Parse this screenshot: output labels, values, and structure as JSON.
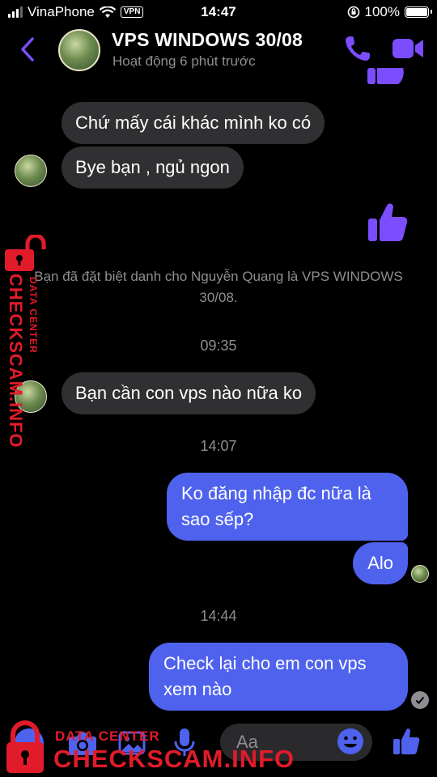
{
  "status_bar": {
    "carrier": "VinaPhone",
    "vpn": "VPN",
    "time": "14:47",
    "battery": "100%"
  },
  "header": {
    "title": "VPS WINDOWS 30/08",
    "subtitle": "Hoạt động 6 phút trước"
  },
  "messages": {
    "in_1": "Chứ mấy cái khác mình ko có",
    "in_2": "Bye bạn , ngủ ngon",
    "system_note": "Bạn đã đặt biệt danh cho Nguyễn Quang là VPS WINDOWS 30/08.",
    "time_1": "09:35",
    "in_3": "Bạn cần con vps nào nữa ko",
    "time_2": "14:07",
    "out_1": "Ko đăng nhập đc nữa là sao sếp?",
    "out_2": "Alo",
    "time_3": "14:44",
    "out_3": "Check lại cho em con vps xem nào"
  },
  "composer": {
    "placeholder": "Aa"
  },
  "watermark": {
    "brand": "CHECKSCAM.INFO",
    "tagline": "DATA CENTER"
  },
  "colors": {
    "accent": "#7b4dff",
    "outgoing_bubble": "#4f62ee",
    "incoming_bubble": "#303033",
    "watermark": "#e21b2a"
  }
}
